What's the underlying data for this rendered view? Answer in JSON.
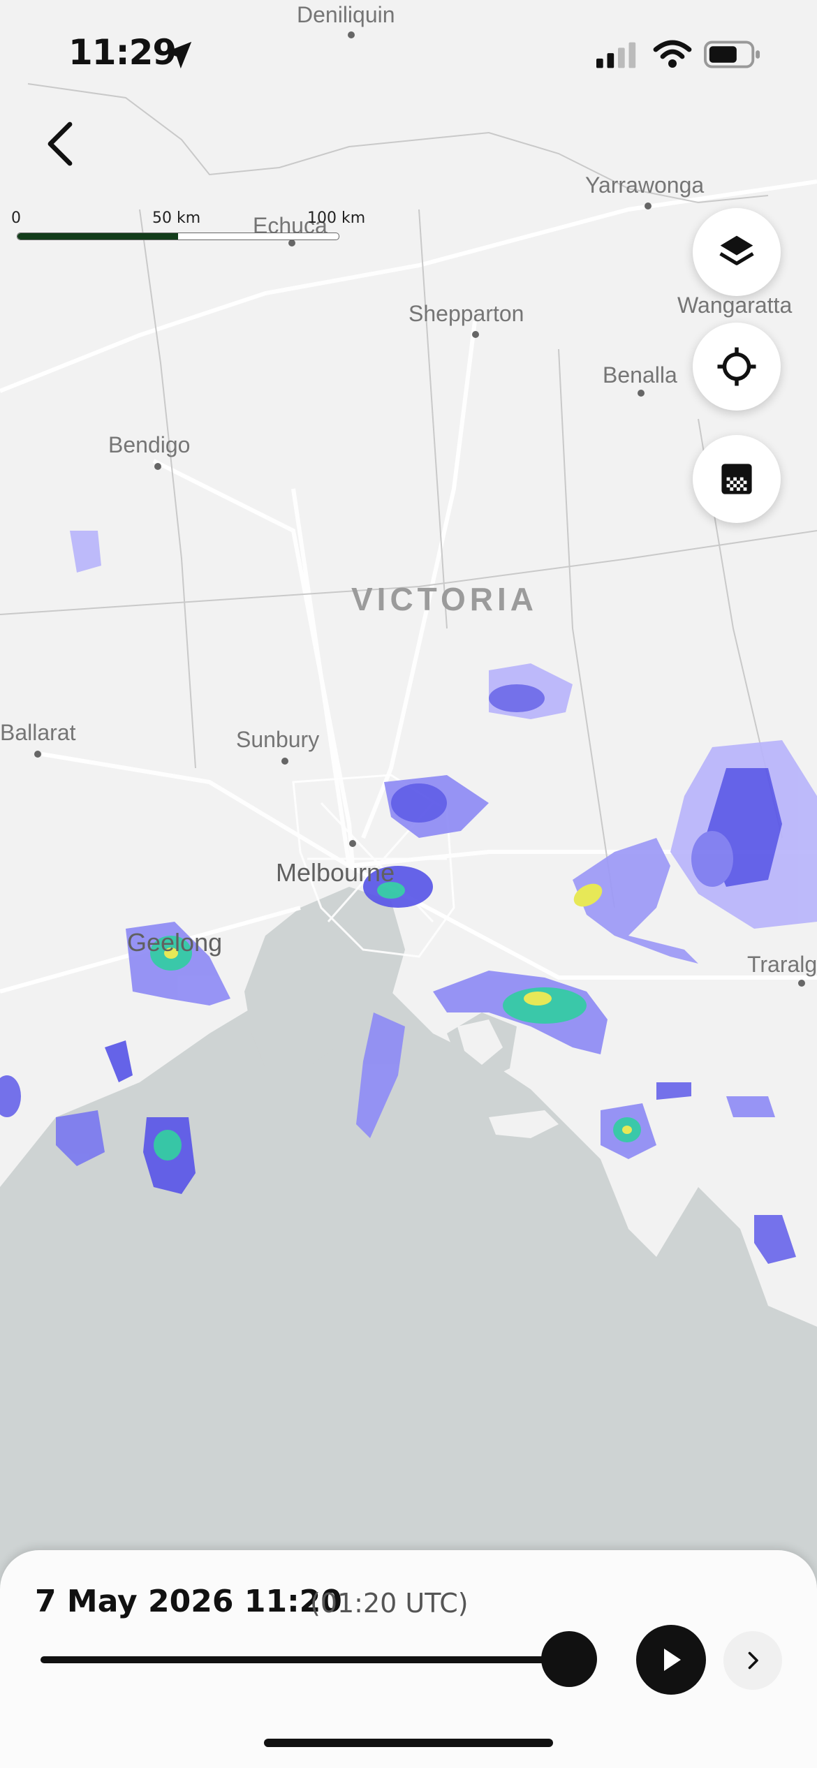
{
  "status_bar": {
    "time": "11:29",
    "icons": [
      "location-arrow-icon",
      "cellular-signal-icon",
      "wifi-icon",
      "battery-icon"
    ]
  },
  "nav": {
    "back_icon": "chevron-left-icon"
  },
  "scale_bar": {
    "labels": [
      "0",
      "50 km",
      "100 km"
    ]
  },
  "map_controls": {
    "layers_icon": "layers-icon",
    "locate_icon": "crosshair-icon",
    "legend_icon": "checker-legend-icon"
  },
  "map": {
    "region_label": "VICTORIA",
    "places": [
      {
        "name": "Deniliquin"
      },
      {
        "name": "Echuca"
      },
      {
        "name": "Yarrawonga"
      },
      {
        "name": "Shepparton"
      },
      {
        "name": "Wangaratta"
      },
      {
        "name": "Benalla"
      },
      {
        "name": "Bendigo"
      },
      {
        "name": "Sunbury"
      },
      {
        "name": "Ballarat"
      },
      {
        "name": "Melbourne"
      },
      {
        "name": "Geelong"
      },
      {
        "name": "Traralg"
      }
    ],
    "colors": {
      "land": "#f2f2f2",
      "water": "#ced3d3",
      "radar_light": "#b9b5fb",
      "radar_mid": "#5a57e8",
      "radar_heavy": "#2bc5a3",
      "radar_peak": "#e7e84a"
    }
  },
  "playback": {
    "date_time": "7 May 2026 11:20",
    "utc": "(01:20 UTC)",
    "progress": 0.97,
    "play_icon": "play-icon",
    "next_icon": "chevron-right-icon"
  }
}
